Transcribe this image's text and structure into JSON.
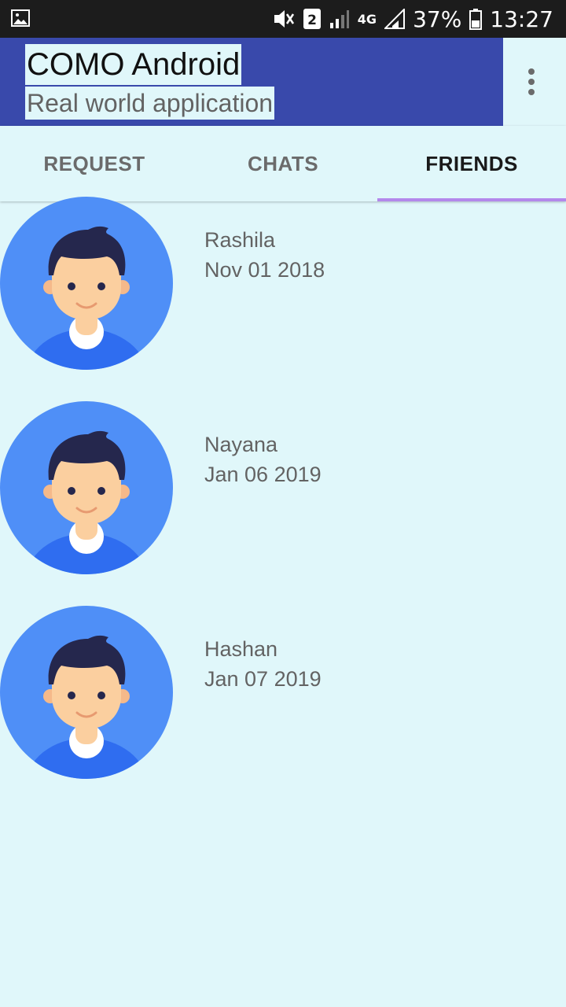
{
  "status_bar": {
    "sim_slot": "2",
    "network": "4G",
    "battery": "37%",
    "time": "13:27",
    "icons": [
      "gallery-icon",
      "mute-icon",
      "sim-icon",
      "signal-icon",
      "battery-icon"
    ]
  },
  "app_bar": {
    "title": "COMO Android",
    "subtitle": "Real world application",
    "overflow_icon": "more-vert-icon",
    "color": "#3949ab"
  },
  "tabs": [
    {
      "label": "REQUEST",
      "active": false
    },
    {
      "label": "CHATS",
      "active": false
    },
    {
      "label": "FRIENDS",
      "active": true
    }
  ],
  "friends": [
    {
      "name": "Rashila",
      "date": "Nov 01 2018"
    },
    {
      "name": "Nayana",
      "date": "Jan 06 2019"
    },
    {
      "name": "Hashan",
      "date": "Jan 07 2019"
    }
  ],
  "colors": {
    "background": "#e0f7fa",
    "tab_indicator": "#b388eb",
    "avatar_bg": "#4f8ff7"
  }
}
